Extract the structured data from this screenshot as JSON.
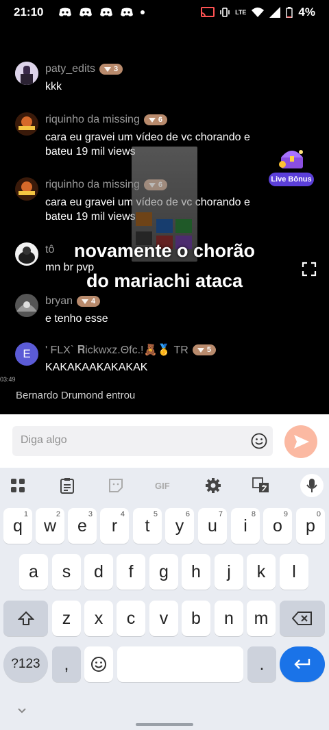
{
  "status_bar": {
    "time": "21:10",
    "battery": "4%",
    "network": "LTE"
  },
  "messages": [
    {
      "user": "paty_edits",
      "level": "3",
      "text": "kkk"
    },
    {
      "user": "riquinho da missing",
      "level": "6",
      "text": "cara eu gravei um vídeo de vc chorando e bateu 19 mil views"
    },
    {
      "user": "riquinho da missing",
      "level": "6",
      "text": "cara eu gravei um vídeo de vc chorando e bateu 19 mil views"
    },
    {
      "user": "tô",
      "level": "",
      "text": "mn br pvp"
    },
    {
      "user": "bryan",
      "level": "4",
      "text": "e tenho esse"
    },
    {
      "user": "' FLX` 𝐑ickwxz.Θfc.!🧸🥇 TR",
      "level": "5",
      "text": "KAKAKAAKAKAKAK",
      "avatar_letter": "E"
    }
  ],
  "join_notice": {
    "name": "Bernardo Drumond",
    "suffix": " entrou"
  },
  "tiny_time": "03:49",
  "caption": {
    "line1": "novamente o chorão",
    "line2": "do mariachi ataca"
  },
  "bonus_label": "Live Bônus",
  "input": {
    "placeholder": "Diga algo"
  },
  "keyboard": {
    "row1": [
      [
        "q",
        "1"
      ],
      [
        "w",
        "2"
      ],
      [
        "e",
        "3"
      ],
      [
        "r",
        "4"
      ],
      [
        "t",
        "5"
      ],
      [
        "y",
        "6"
      ],
      [
        "u",
        "7"
      ],
      [
        "i",
        "8"
      ],
      [
        "o",
        "9"
      ],
      [
        "p",
        "0"
      ]
    ],
    "row2": [
      "a",
      "s",
      "d",
      "f",
      "g",
      "h",
      "j",
      "k",
      "l"
    ],
    "row3": [
      "z",
      "x",
      "c",
      "v",
      "b",
      "n",
      "m"
    ],
    "symbols_label": "?123",
    "comma": ",",
    "period": "."
  },
  "colors": {
    "accent_purple": "#5b3fd8",
    "badge": "#b88a6c",
    "send": "#fbb9a2",
    "enter": "#1a73e8"
  }
}
